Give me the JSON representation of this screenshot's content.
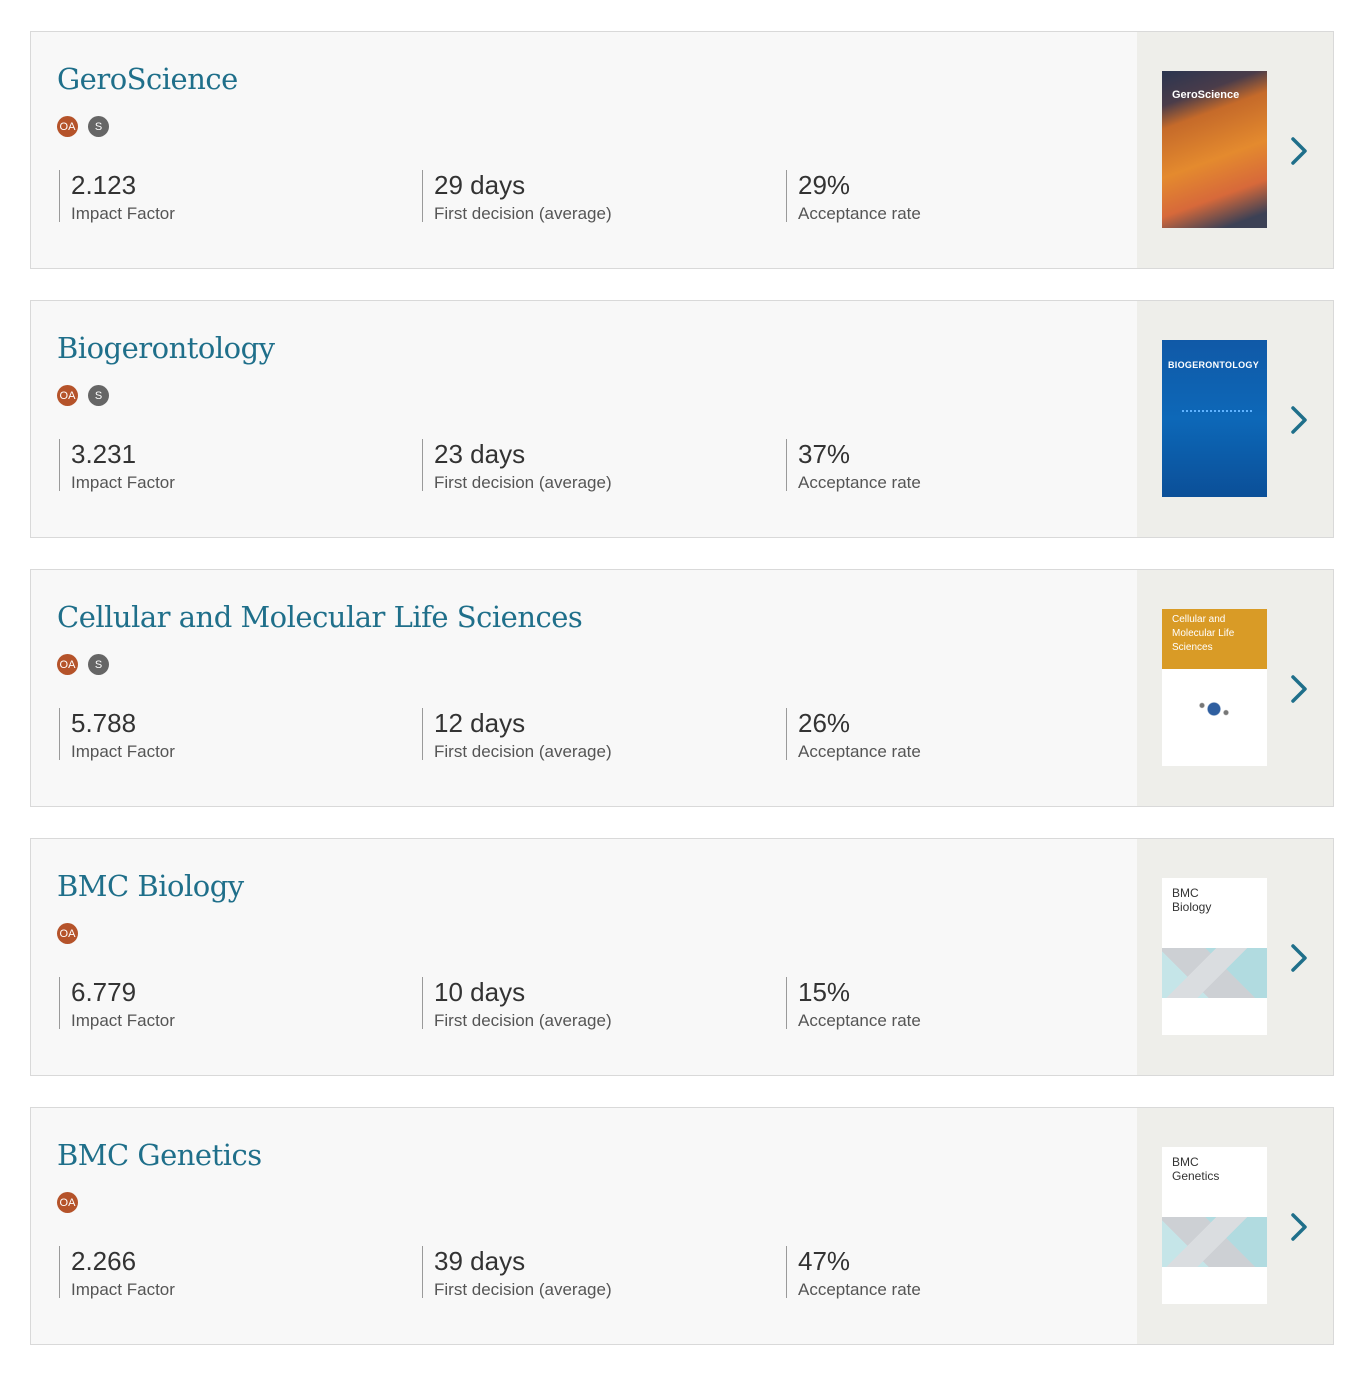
{
  "metric_labels": {
    "impact": "Impact Factor",
    "decision": "First decision (average)",
    "acceptance": "Acceptance rate"
  },
  "journals": [
    {
      "name": "GeroScience",
      "badges": [
        "OA",
        "S"
      ],
      "impact_factor": "2.123",
      "first_decision": "29 days",
      "acceptance_rate": "29%",
      "cover_title": "GeroScience"
    },
    {
      "name": "Biogerontology",
      "badges": [
        "OA",
        "S"
      ],
      "impact_factor": "3.231",
      "first_decision": "23 days",
      "acceptance_rate": "37%",
      "cover_title": "BIOGERONTOLOGY"
    },
    {
      "name": "Cellular and Molecular Life Sciences",
      "badges": [
        "OA",
        "S"
      ],
      "impact_factor": "5.788",
      "first_decision": "12 days",
      "acceptance_rate": "26%",
      "cover_title": "Cellular and Molecular Life Sciences"
    },
    {
      "name": "BMC Biology",
      "badges": [
        "OA"
      ],
      "impact_factor": "6.779",
      "first_decision": "10 days",
      "acceptance_rate": "15%",
      "cover_title": "BMC Biology"
    },
    {
      "name": "BMC Genetics",
      "badges": [
        "OA"
      ],
      "impact_factor": "2.266",
      "first_decision": "39 days",
      "acceptance_rate": "47%",
      "cover_title": "BMC Genetics"
    }
  ],
  "colors": {
    "title": "#1f6f8a",
    "oa_badge": "#b5532a",
    "s_badge": "#666666",
    "chevron": "#1f6f8a"
  },
  "icons": {
    "chevron": "chevron-right-icon"
  }
}
